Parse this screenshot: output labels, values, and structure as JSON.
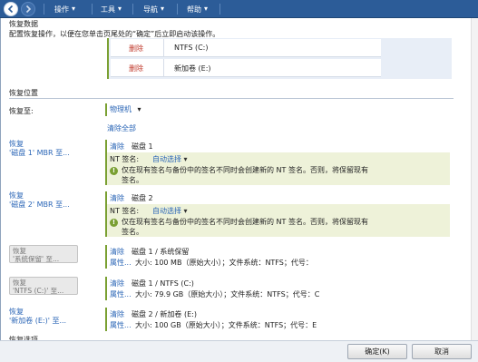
{
  "toolbar": {
    "menus": [
      {
        "label": "操作"
      },
      {
        "label": "工具"
      },
      {
        "label": "导航"
      },
      {
        "label": "帮助"
      }
    ]
  },
  "restore_data": {
    "title": "恢复数据",
    "description": "配置恢复操作，以便在您单击页尾处的“确定”后立即启动该操作。",
    "rows": [
      {
        "action": "删除",
        "volume": "NTFS (C:)"
      },
      {
        "action": "删除",
        "volume": "新加卷 (E:)"
      }
    ]
  },
  "restore_location": {
    "title": "恢复位置",
    "restore_to_label": "恢复至:",
    "restore_to_value": "物理机",
    "clear_all": "清除全部",
    "disks": [
      {
        "label_line1": "恢复",
        "label_line2": "'磁盘 1' MBR 至...",
        "clear": "清除",
        "target": "磁盘 1",
        "nt_label": "NT 签名:",
        "nt_value": "自动选择",
        "warning_line1": "仅在现有签名与备份中的签名不同时会创建新的 NT 签名。否则，将保留现有",
        "warning_line2": "签名。"
      },
      {
        "label_line1": "恢复",
        "label_line2": "'磁盘 2' MBR 至...",
        "clear": "清除",
        "target": "磁盘 2",
        "nt_label": "NT 签名:",
        "nt_value": "自动选择",
        "warning_line1": "仅在现有签名与备份中的签名不同时会创建新的 NT 签名。否则，将保留现有",
        "warning_line2": "签名。"
      }
    ],
    "volumes": [
      {
        "label_line1": "恢复",
        "label_line2": "'系统保留' 至...",
        "disabled": true,
        "clear": "清除",
        "target": "磁盘 1 / 系统保留",
        "props": "属性...",
        "details": "大小: 100 MB（原始大小）；文件系统：NTFS；代号："
      },
      {
        "label_line1": "恢复",
        "label_line2": "'NTFS (C:)' 至...",
        "disabled": true,
        "clear": "清除",
        "target": "磁盘 1 / NTFS (C:)",
        "props": "属性...",
        "details": "大小: 79.9 GB（原始大小）；文件系统：NTFS；代号：C"
      },
      {
        "label_line1": "恢复",
        "label_line2": "'新加卷 (E:)' 至...",
        "disabled": false,
        "clear": "清除",
        "target": "磁盘 2 / 新加卷 (E:)",
        "props": "属性...",
        "details": "大小: 100 GB（原始大小）；文件系统：NTFS；代号：E"
      }
    ]
  },
  "footer": {
    "partial_heading": "恢复选项",
    "ok_label": "确定(K)",
    "cancel_label": "取消"
  }
}
